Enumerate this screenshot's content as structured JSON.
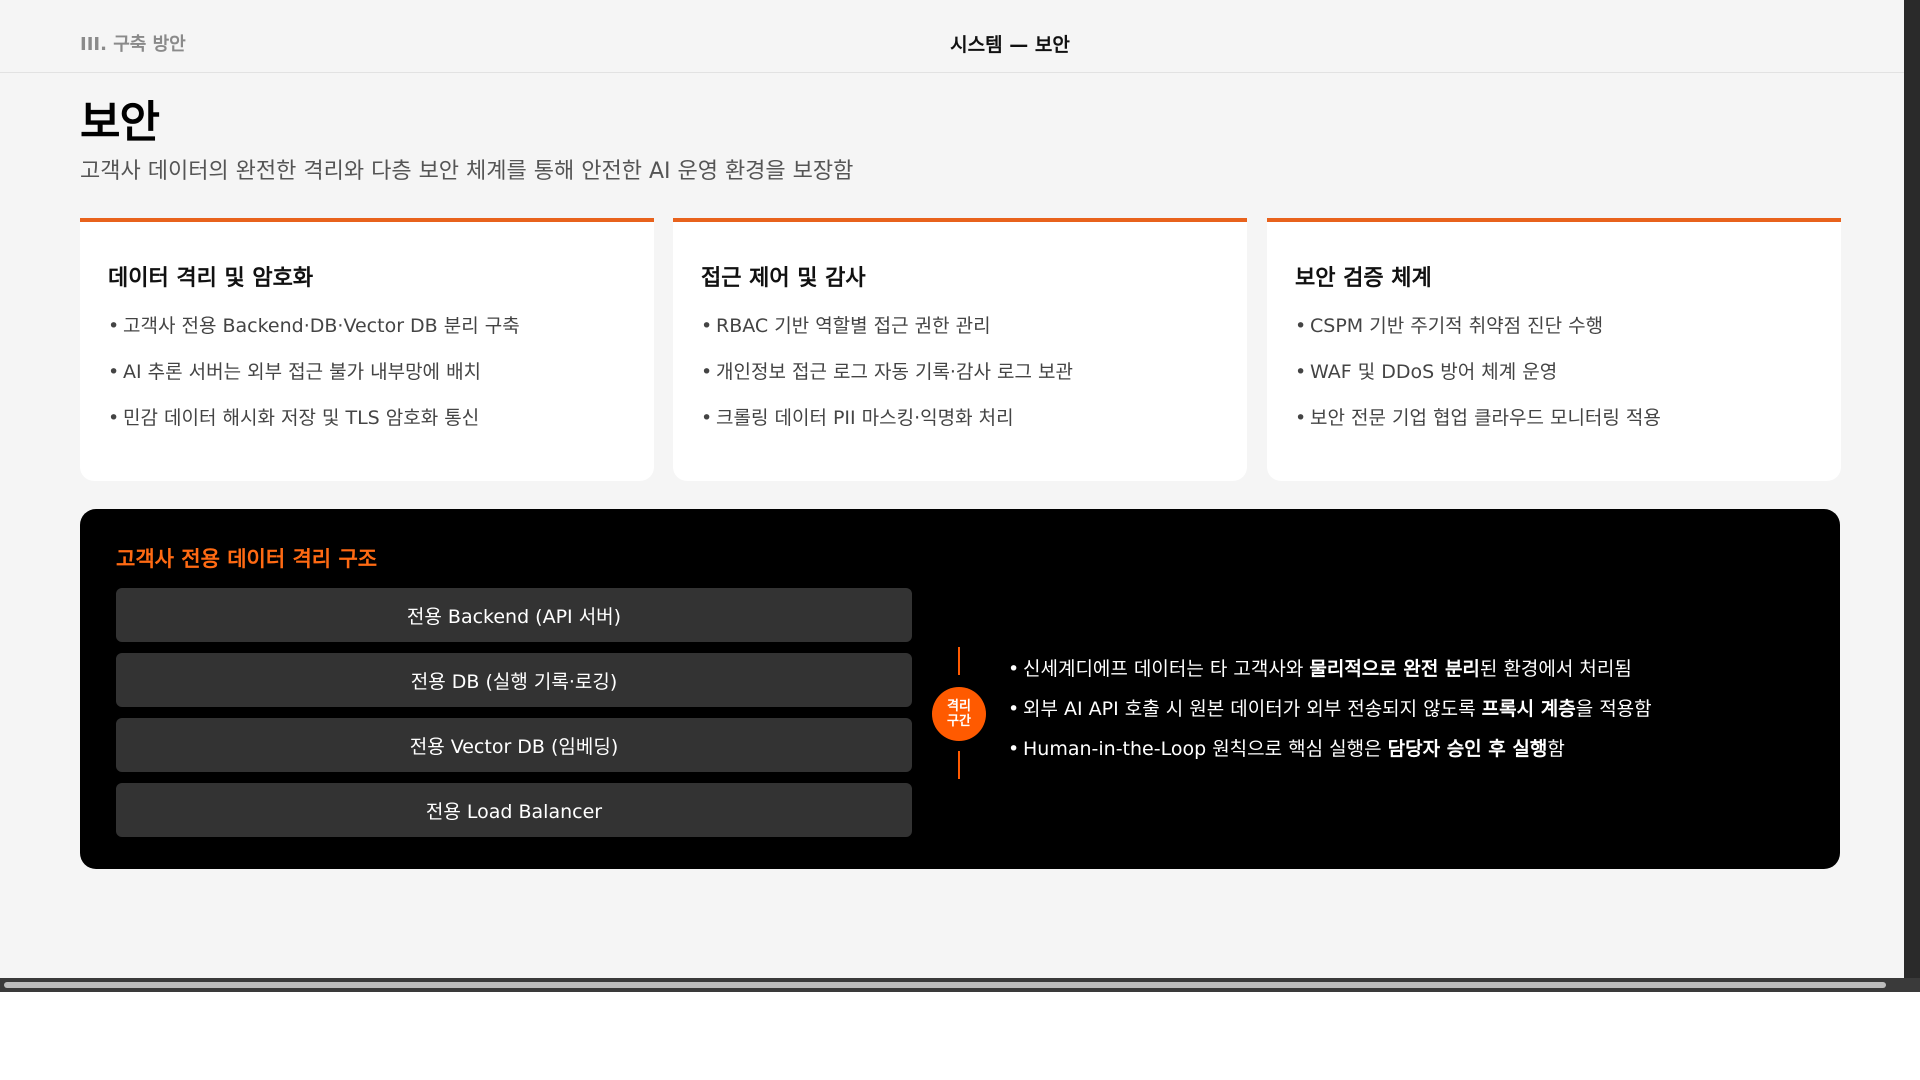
{
  "header": {
    "section_label": "III. 구축 방안",
    "title": "시스템 — 보안"
  },
  "page": {
    "title": "보안",
    "subtitle": "고객사 데이터의 완전한 격리와 다층 보안 체계를 통해 안전한 AI 운영 환경을 보장함"
  },
  "colors": {
    "accent": "#e8621c",
    "panel_title": "#ff6a13",
    "separator": "#ff5a00",
    "panel_bg": "#000000",
    "layer_bg": "#333333"
  },
  "cards": [
    {
      "title": "데이터 격리 및 암호화",
      "items": [
        "고객사 전용 Backend·DB·Vector DB 분리 구축",
        "AI 추론 서버는 외부 접근 불가 내부망에 배치",
        "민감 데이터 해시화 저장 및 TLS 암호화 통신"
      ]
    },
    {
      "title": "접근 제어 및 감사",
      "items": [
        "RBAC 기반 역할별 접근 권한 관리",
        "개인정보 접근 로그 자동 기록·감사 로그 보관",
        "크롤링 데이터 PII 마스킹·익명화 처리"
      ]
    },
    {
      "title": "보안 검증 체계",
      "items": [
        "CSPM 기반 주기적 취약점 진단 수행",
        "WAF 및 DDoS 방어 체계 운영",
        "보안 전문 기업 협업 클라우드 모니터링 적용"
      ]
    }
  ],
  "isolation": {
    "title": "고객사 전용 데이터 격리 구조",
    "layers": [
      "전용 Backend (API 서버)",
      "전용 DB (실행 기록·로깅)",
      "전용 Vector DB (임베딩)",
      "전용 Load Balancer"
    ],
    "separator_label_line1": "격리",
    "separator_label_line2": "구간",
    "notes": [
      {
        "pre": "신세계디에프 데이터는 타 고객사와 ",
        "bold": "물리적으로 완전 분리",
        "post": "된 환경에서 처리됨"
      },
      {
        "pre": "외부 AI API 호출 시 원본 데이터가 외부 전송되지 않도록 ",
        "bold": "프록시 계층",
        "post": "을 적용함"
      },
      {
        "pre": "Human-in-the-Loop 원칙으로 핵심 실행은 ",
        "bold": "담당자 승인 후 실행",
        "post": "함"
      }
    ]
  },
  "bullet_glyph": "•"
}
